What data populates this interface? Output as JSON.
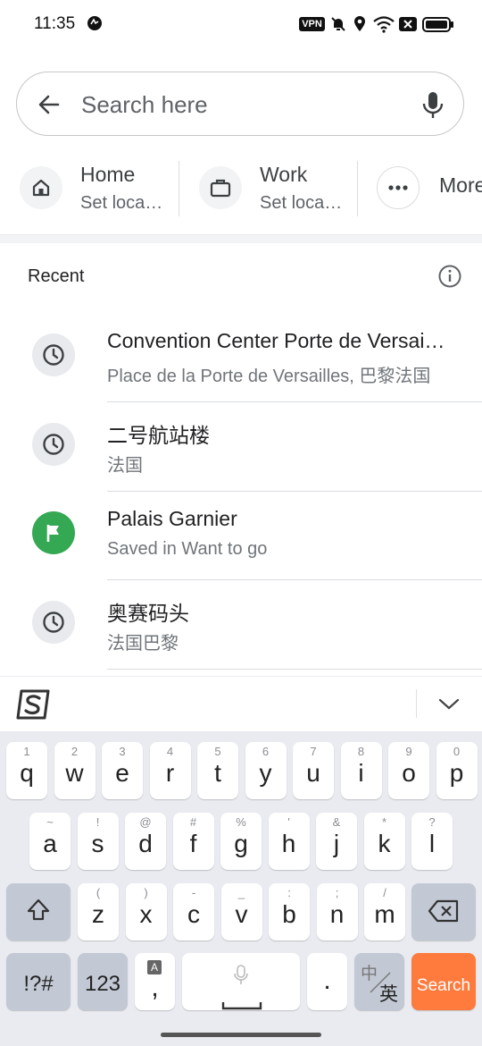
{
  "status_bar": {
    "time": "11:35",
    "icons": [
      "vpn-badge",
      "bell-off-icon",
      "location-icon",
      "wifi-icon",
      "sim-icon",
      "battery-icon"
    ],
    "vpn_label": "VPN"
  },
  "search": {
    "placeholder": "Search here"
  },
  "shortcuts": [
    {
      "title": "Home",
      "subtitle": "Set loca…",
      "icon": "home-icon"
    },
    {
      "title": "Work",
      "subtitle": "Set loca…",
      "icon": "briefcase-icon"
    },
    {
      "title": "More",
      "icon": "more-horizontal-icon"
    }
  ],
  "recent": {
    "title": "Recent",
    "items": [
      {
        "title": "Convention Center Porte de Versai…",
        "subtitle": "Place de la Porte de Versailles, 巴黎法国",
        "icon": "history-icon"
      },
      {
        "title": "二号航站楼",
        "subtitle": "法国",
        "icon": "history-icon"
      },
      {
        "title": "Palais Garnier",
        "subtitle": "Saved in Want to go",
        "icon": "flag-icon",
        "icon_color": "#34a853"
      },
      {
        "title": "奥赛码头",
        "subtitle": "法国巴黎",
        "icon": "history-icon"
      }
    ]
  },
  "keyboard": {
    "row1": [
      {
        "key": "q",
        "hint": "1"
      },
      {
        "key": "w",
        "hint": "2"
      },
      {
        "key": "e",
        "hint": "3"
      },
      {
        "key": "r",
        "hint": "4"
      },
      {
        "key": "t",
        "hint": "5"
      },
      {
        "key": "y",
        "hint": "6"
      },
      {
        "key": "u",
        "hint": "7"
      },
      {
        "key": "i",
        "hint": "8"
      },
      {
        "key": "o",
        "hint": "9"
      },
      {
        "key": "p",
        "hint": "0"
      }
    ],
    "row2": [
      {
        "key": "a",
        "hint": "~"
      },
      {
        "key": "s",
        "hint": "!"
      },
      {
        "key": "d",
        "hint": "@"
      },
      {
        "key": "f",
        "hint": "#"
      },
      {
        "key": "g",
        "hint": "%"
      },
      {
        "key": "h",
        "hint": "'"
      },
      {
        "key": "j",
        "hint": "&"
      },
      {
        "key": "k",
        "hint": "*"
      },
      {
        "key": "l",
        "hint": "?"
      }
    ],
    "row3": [
      {
        "key": "z",
        "hint": "("
      },
      {
        "key": "x",
        "hint": ")"
      },
      {
        "key": "c",
        "hint": "-"
      },
      {
        "key": "v",
        "hint": "_"
      },
      {
        "key": "b",
        "hint": ":"
      },
      {
        "key": "n",
        "hint": ";"
      },
      {
        "key": "m",
        "hint": "/"
      }
    ],
    "symbols_label": "!?#",
    "numbers_label": "123",
    "comma_key": ",",
    "comma_badge": "A",
    "period_key": ".",
    "lang_top": "中",
    "lang_bottom": "英",
    "search_label": "Search",
    "accent_color": "#ff7a3d"
  }
}
